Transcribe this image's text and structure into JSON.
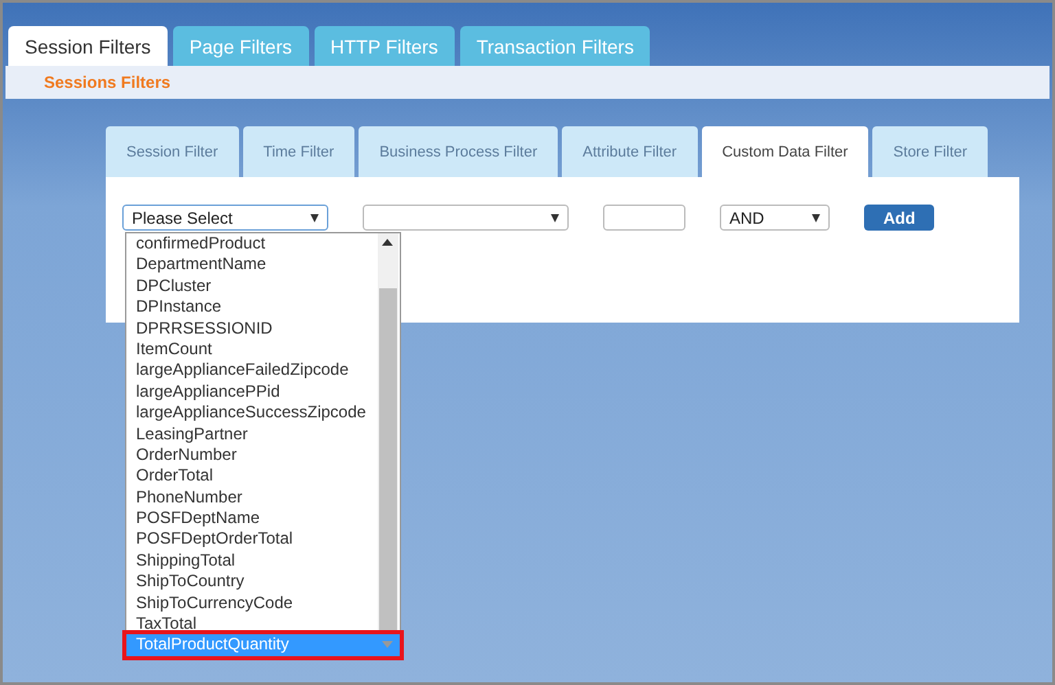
{
  "top_tabs": [
    {
      "label": "Session Filters",
      "selected": true
    },
    {
      "label": "Page Filters",
      "selected": false
    },
    {
      "label": "HTTP Filters",
      "selected": false
    },
    {
      "label": "Transaction Filters",
      "selected": false
    }
  ],
  "subtitle": "Sessions Filters",
  "filter_tabs": [
    {
      "label": "Session Filter",
      "selected": false
    },
    {
      "label": "Time Filter",
      "selected": false
    },
    {
      "label": "Business Process Filter",
      "selected": false
    },
    {
      "label": "Attribute Filter",
      "selected": false
    },
    {
      "label": "Custom Data Filter",
      "selected": true
    },
    {
      "label": "Store Filter",
      "selected": false
    }
  ],
  "field_select": {
    "value": "Please Select",
    "focused": true
  },
  "logic_select": {
    "value": "AND"
  },
  "add_button": "Add",
  "dropdown": {
    "items": [
      {
        "label": "confirmedProduct",
        "selected": false,
        "outlined": false
      },
      {
        "label": "DepartmentName",
        "selected": false,
        "outlined": false
      },
      {
        "label": "DPCluster",
        "selected": false,
        "outlined": false
      },
      {
        "label": "DPInstance",
        "selected": false,
        "outlined": false
      },
      {
        "label": "DPRRSESSIONID",
        "selected": false,
        "outlined": false
      },
      {
        "label": "ItemCount",
        "selected": false,
        "outlined": false
      },
      {
        "label": "largeApplianceFailedZipcode",
        "selected": false,
        "outlined": false
      },
      {
        "label": "largeAppliancePPid",
        "selected": false,
        "outlined": false
      },
      {
        "label": "largeApplianceSuccessZipcode",
        "selected": false,
        "outlined": false
      },
      {
        "label": "LeasingPartner",
        "selected": false,
        "outlined": false
      },
      {
        "label": "OrderNumber",
        "selected": false,
        "outlined": false
      },
      {
        "label": "OrderTotal",
        "selected": false,
        "outlined": false
      },
      {
        "label": "PhoneNumber",
        "selected": false,
        "outlined": false
      },
      {
        "label": "POSFDeptName",
        "selected": false,
        "outlined": false
      },
      {
        "label": "POSFDeptOrderTotal",
        "selected": false,
        "outlined": false
      },
      {
        "label": "ShippingTotal",
        "selected": false,
        "outlined": false
      },
      {
        "label": "ShipToCountry",
        "selected": false,
        "outlined": false
      },
      {
        "label": "ShipToCurrencyCode",
        "selected": false,
        "outlined": false
      },
      {
        "label": "TaxTotal",
        "selected": false,
        "outlined": false
      },
      {
        "label": "TotalProductQuantity",
        "selected": true,
        "outlined": true
      }
    ]
  }
}
